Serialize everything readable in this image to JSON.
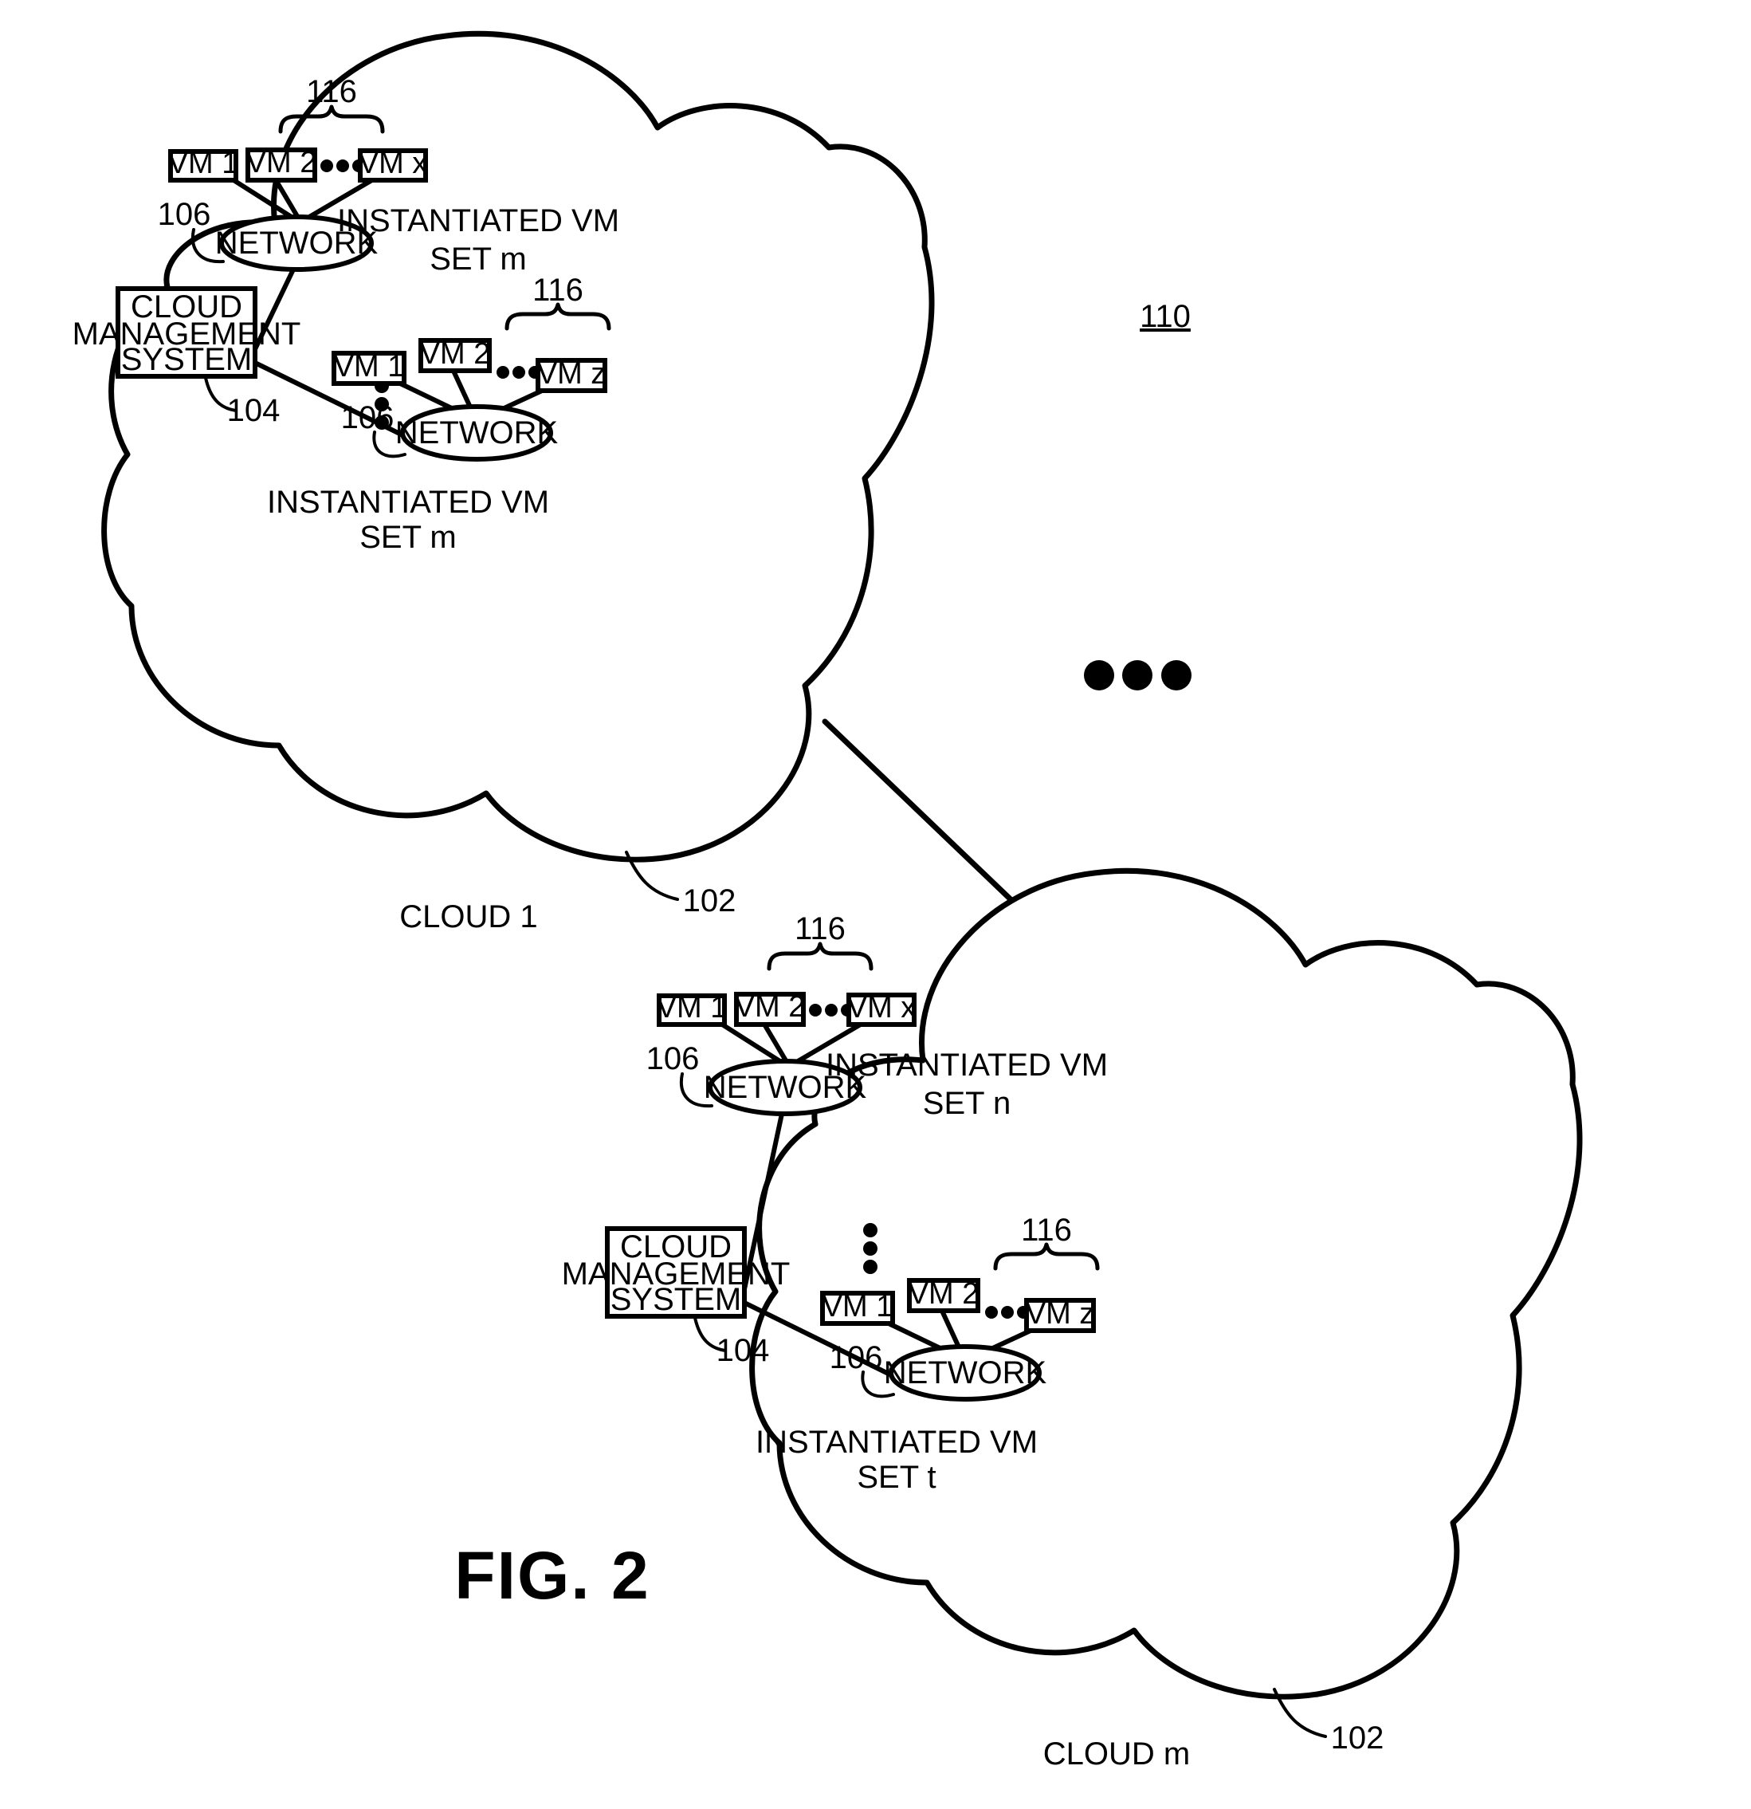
{
  "figure": {
    "caption": "FIG. 2",
    "system_ref": "110"
  },
  "clouds": [
    {
      "id": "cloud-1",
      "name": "CLOUD 1",
      "ref": "102",
      "management_system": {
        "label_line1": "CLOUD",
        "label_line2": "MANAGEMENT",
        "label_line3": "SYSTEM",
        "ref": "104"
      },
      "vm_sets": [
        {
          "id": "cloud-1-set-upper",
          "set_label_line1": "INSTANTIATED VM",
          "set_label_line2": "SET m",
          "network_label": "NETWORK",
          "network_ref": "106",
          "group_ref": "116",
          "vms": [
            "VM 1",
            "VM 2",
            "VM x"
          ],
          "ellipsis": "•••"
        },
        {
          "id": "cloud-1-set-lower",
          "set_label_line1": "INSTANTIATED VM",
          "set_label_line2": "SET m",
          "network_label": "NETWORK",
          "network_ref": "106",
          "group_ref": "116",
          "vms": [
            "VM 1",
            "VM 2",
            "VM z"
          ],
          "ellipsis": "•••"
        }
      ]
    },
    {
      "id": "cloud-m",
      "name": "CLOUD m",
      "ref": "102",
      "management_system": {
        "label_line1": "CLOUD",
        "label_line2": "MANAGEMENT",
        "label_line3": "SYSTEM",
        "ref": "104"
      },
      "vm_sets": [
        {
          "id": "cloud-m-set-upper",
          "set_label_line1": "INSTANTIATED VM",
          "set_label_line2": "SET n",
          "network_label": "NETWORK",
          "network_ref": "106",
          "group_ref": "116",
          "vms": [
            "VM 1",
            "VM 2",
            "VM x"
          ],
          "ellipsis": "•••"
        },
        {
          "id": "cloud-m-set-lower",
          "set_label_line1": "INSTANTIATED VM",
          "set_label_line2": "SET t",
          "network_label": "NETWORK",
          "network_ref": "106",
          "group_ref": "116",
          "vms": [
            "VM 1",
            "VM 2",
            "VM z"
          ],
          "ellipsis": "•••"
        }
      ]
    }
  ],
  "colors": {
    "ink": "#000000",
    "paper": "#ffffff"
  }
}
